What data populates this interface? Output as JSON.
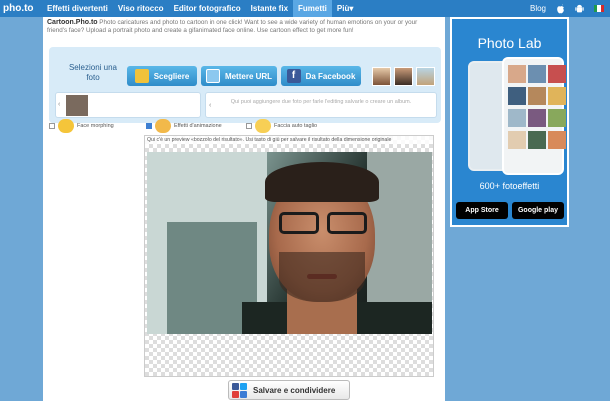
{
  "nav": {
    "logo": "pho.to",
    "items": [
      {
        "label": "Effetti divertenti",
        "active": false
      },
      {
        "label": "Viso ritocco",
        "active": false
      },
      {
        "label": "Editor fotografico",
        "active": false
      },
      {
        "label": "Istante fix",
        "active": false
      },
      {
        "label": "Fumetti",
        "active": true
      },
      {
        "label": "Più▾",
        "active": false
      }
    ],
    "blog": "Blog",
    "icons": [
      "apple-icon",
      "android-icon",
      "italy-flag-icon"
    ]
  },
  "intro": {
    "title": "Cartoon.Pho.to",
    "text": " Photo caricatures and photo to cartoon in one click! Want to see a wide variety of human emotions on your or your friend's face? Upload a portrait photo and create a gifanimated face online. Use cartoon effect to get more fun!"
  },
  "select": {
    "title": "Selezioni una foto",
    "choose": "Scegliere",
    "url": "Mettere URL",
    "facebook": "Da Facebook",
    "hint": "Qui puoi aggiungere due foto per farle l'editing salvarle o creare un album."
  },
  "effects": [
    {
      "label": "Face morphing",
      "checked": false
    },
    {
      "label": "Effetti d'animazione",
      "checked": true
    },
    {
      "label": "Faccia auto taglio",
      "checked": false
    }
  ],
  "preview": {
    "note": "Qui c'è un preview «bozzolo del risultato». Usi tasto di giù per salvare il risultato della dimensione originale"
  },
  "share": {
    "label": "Salvare e condividere"
  },
  "ad": {
    "title": "Photo Lab",
    "count": "600+ fotoeffetti",
    "appstore": "App Store",
    "googleplay": "Google play"
  },
  "colors": {
    "nav_bg": "#2b7ec4",
    "nav_active": "#5aa7e4",
    "page_bg": "#6fa8d6",
    "button": "#3d93cf"
  }
}
